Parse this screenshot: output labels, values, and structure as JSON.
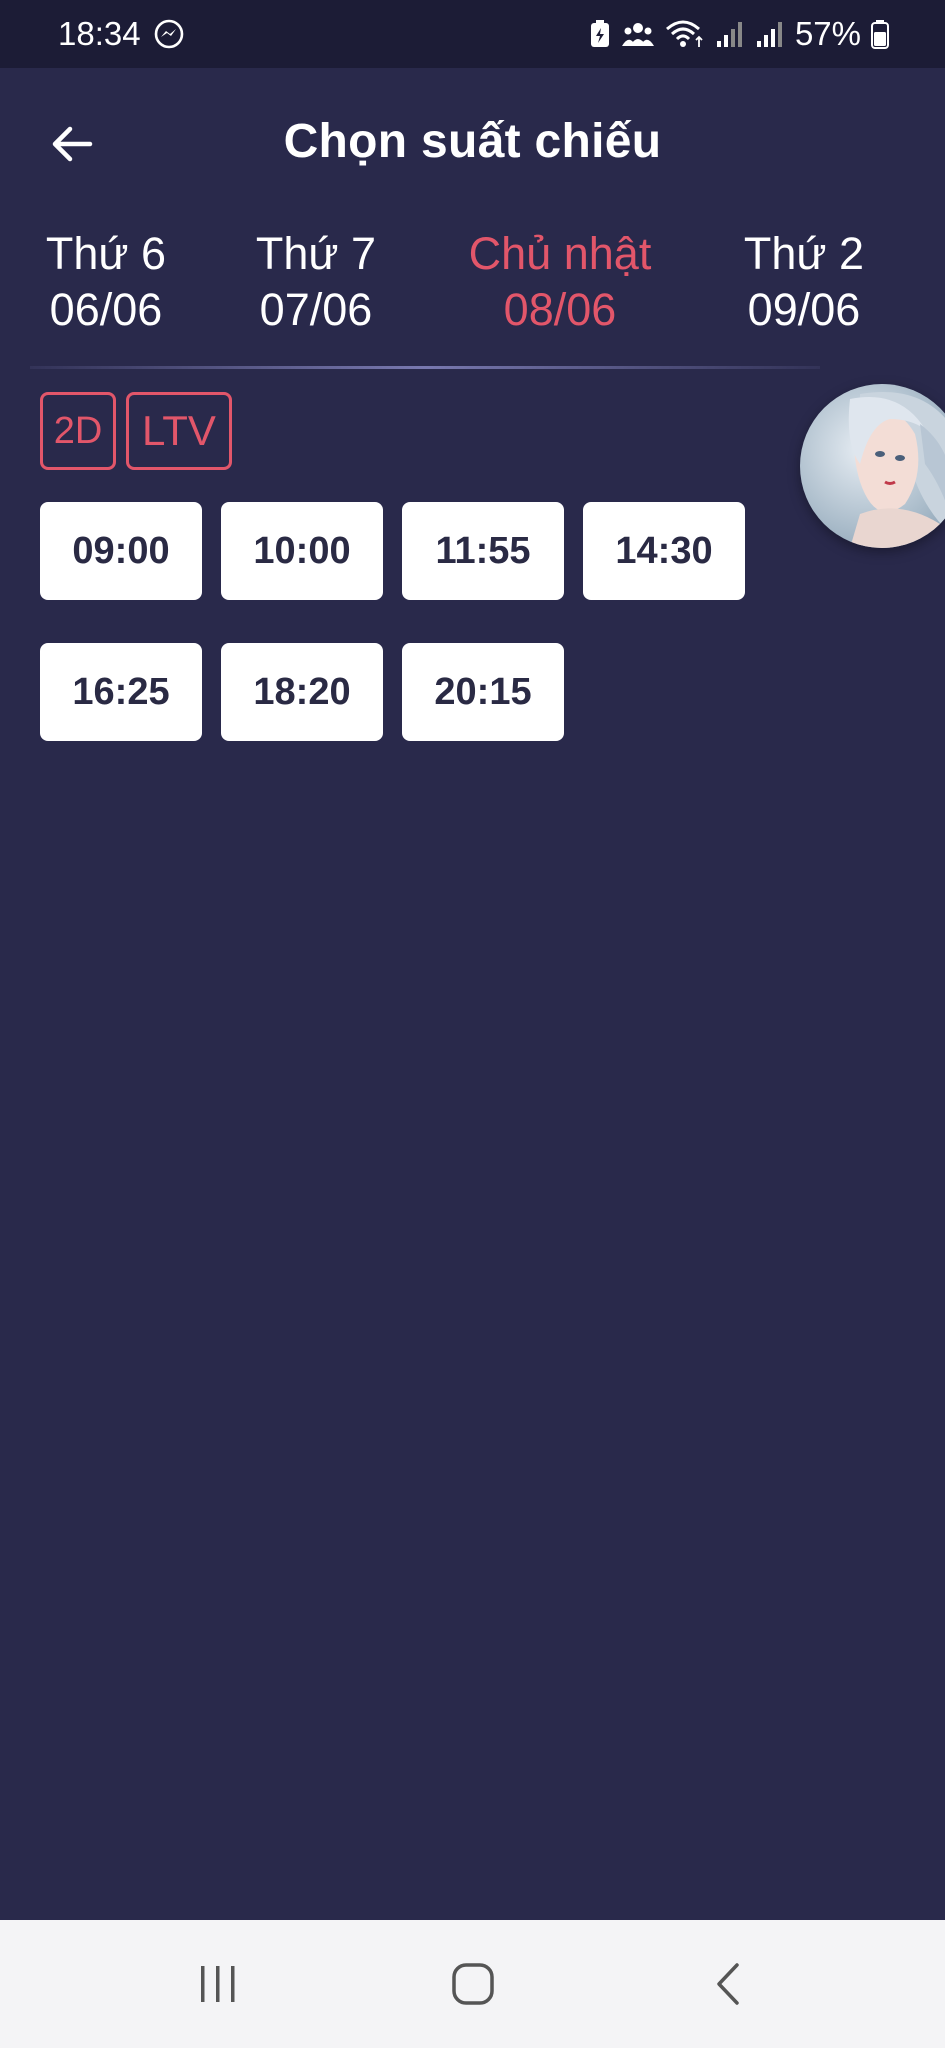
{
  "status_bar": {
    "time": "18:34",
    "battery_percent": "57%",
    "icons": [
      "messenger-icon",
      "battery-saver-icon",
      "group-icon",
      "wifi-icon",
      "signal-icon",
      "signal-icon",
      "battery-icon"
    ]
  },
  "header": {
    "title": "Chọn suất chiếu",
    "back_icon": "arrow-left-icon"
  },
  "date_tabs": [
    {
      "day": "Thứ 6",
      "date": "06/06",
      "active": false
    },
    {
      "day": "Thứ 7",
      "date": "07/06",
      "active": false
    },
    {
      "day": "Chủ nhật",
      "date": "08/06",
      "active": true
    },
    {
      "day": "Thứ 2",
      "date": "09/06",
      "active": false
    }
  ],
  "formats": [
    "2D",
    "LTV"
  ],
  "showtimes": [
    "09:00",
    "10:00",
    "11:55",
    "14:30",
    "16:25",
    "18:20",
    "20:15"
  ],
  "colors": {
    "background": "#29294b",
    "status_bar": "#1c1c36",
    "accent": "#e2566a",
    "button_bg": "#ffffff",
    "button_text": "#2a2a44",
    "nav_bar": "#f4f4f6"
  },
  "nav_bar": {
    "icons": [
      "recent-apps-icon",
      "home-icon",
      "back-icon"
    ]
  }
}
